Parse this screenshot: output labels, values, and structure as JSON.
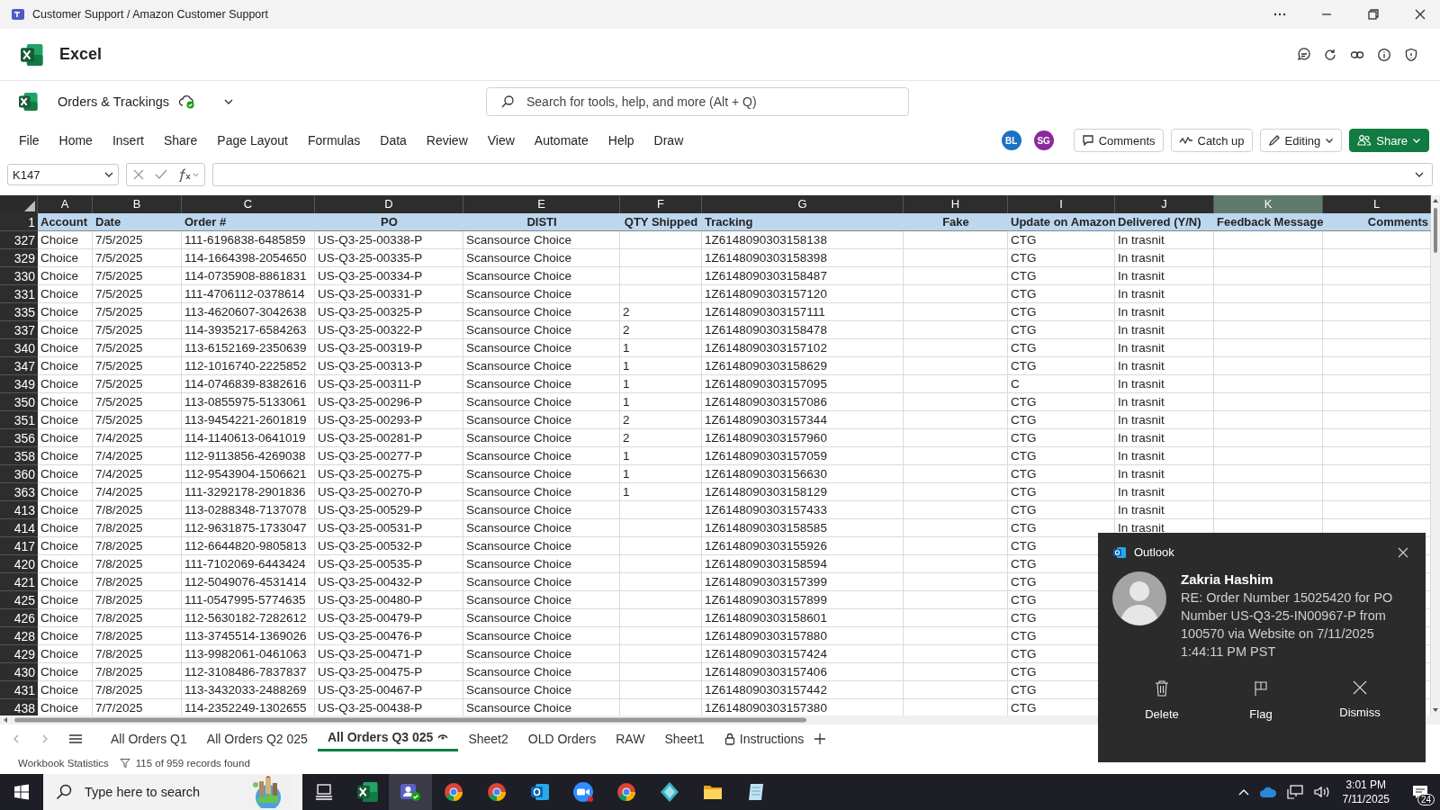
{
  "window": {
    "title": "Customer Support / Amazon Customer Support"
  },
  "app": {
    "name": "Excel"
  },
  "document": {
    "title": "Orders & Trackings",
    "saved": true
  },
  "search": {
    "placeholder": "Search for tools, help, and more (Alt + Q)"
  },
  "menu": [
    "File",
    "Home",
    "Insert",
    "Share",
    "Page Layout",
    "Formulas",
    "Data",
    "Review",
    "View",
    "Automate",
    "Help",
    "Draw"
  ],
  "collaborators": [
    {
      "initials": "BL",
      "color": "#1b72c4"
    },
    {
      "initials": "SG",
      "color": "#8a2a9b"
    }
  ],
  "toolbar_buttons": [
    {
      "label": "Comments",
      "kind": "comments"
    },
    {
      "label": "Catch up",
      "kind": "catchup"
    },
    {
      "label": "Editing",
      "kind": "editing"
    },
    {
      "label": "Share",
      "kind": "share"
    }
  ],
  "name_box": {
    "value": "K147"
  },
  "sheet": {
    "header_row": "1",
    "columns": [
      {
        "letter": "A",
        "header": "Account",
        "selected": false
      },
      {
        "letter": "B",
        "header": "Date",
        "selected": false
      },
      {
        "letter": "C",
        "header": "Order #",
        "selected": false
      },
      {
        "letter": "D",
        "header": "PO",
        "selected": false
      },
      {
        "letter": "E",
        "header": "DISTI",
        "selected": false
      },
      {
        "letter": "F",
        "header": "QTY Shipped",
        "selected": false
      },
      {
        "letter": "G",
        "header": "Tracking",
        "selected": false
      },
      {
        "letter": "H",
        "header": "Fake",
        "selected": false
      },
      {
        "letter": "I",
        "header": "Update on Amazon",
        "selected": false
      },
      {
        "letter": "J",
        "header": "Delivered (Y/N)",
        "selected": false
      },
      {
        "letter": "K",
        "header": "Feedback Message",
        "selected": true
      },
      {
        "letter": "L",
        "header": "Comments",
        "selected": false
      }
    ],
    "rows": [
      {
        "row": "327",
        "account": "Choice",
        "date": "7/5/2025",
        "order": "111-6196838-6485859",
        "po": "US-Q3-25-00338-P",
        "disti": "Scansource Choice",
        "tracking": "1Z6148090303158138",
        "update": "CTG",
        "delivered": "In trasnit"
      },
      {
        "row": "329",
        "account": "Choice",
        "date": "7/5/2025",
        "order": "114-1664398-2054650",
        "po": "US-Q3-25-00335-P",
        "disti": "Scansource Choice",
        "tracking": "1Z6148090303158398",
        "update": "CTG",
        "delivered": "In trasnit"
      },
      {
        "row": "330",
        "account": "Choice",
        "date": "7/5/2025",
        "order": "114-0735908-8861831",
        "po": "US-Q3-25-00334-P",
        "disti": "Scansource Choice",
        "tracking": "1Z6148090303158487",
        "update": "CTG",
        "delivered": "In trasnit"
      },
      {
        "row": "331",
        "account": "Choice",
        "date": "7/5/2025",
        "order": "111-4706112-0378614",
        "po": "US-Q3-25-00331-P",
        "disti": "Scansource Choice",
        "tracking": "1Z6148090303157120",
        "update": "CTG",
        "delivered": "In trasnit"
      },
      {
        "row": "335",
        "account": "Choice",
        "date": "7/5/2025",
        "order": "113-4620607-3042638",
        "po": "US-Q3-25-00325-P",
        "disti": "Scansource Choice",
        "qty": "2",
        "tracking": "1Z6148090303157111",
        "update": "CTG",
        "delivered": "In trasnit"
      },
      {
        "row": "337",
        "account": "Choice",
        "date": "7/5/2025",
        "order": "114-3935217-6584263",
        "po": "US-Q3-25-00322-P",
        "disti": "Scansource Choice",
        "qty": "2",
        "tracking": "1Z6148090303158478",
        "update": "CTG",
        "delivered": "In trasnit"
      },
      {
        "row": "340",
        "account": "Choice",
        "date": "7/5/2025",
        "order": "113-6152169-2350639",
        "po": "US-Q3-25-00319-P",
        "disti": "Scansource Choice",
        "qty": "1",
        "tracking": "1Z6148090303157102",
        "update": "CTG",
        "delivered": "In trasnit"
      },
      {
        "row": "347",
        "account": "Choice",
        "date": "7/5/2025",
        "order": "112-1016740-2225852",
        "po": "US-Q3-25-00313-P",
        "disti": "Scansource Choice",
        "qty": "1",
        "tracking": "1Z6148090303158629",
        "update": "CTG",
        "delivered": "In trasnit"
      },
      {
        "row": "349",
        "account": "Choice",
        "date": "7/5/2025",
        "order": "114-0746839-8382616",
        "po": "US-Q3-25-00311-P",
        "disti": "Scansource Choice",
        "qty": "1",
        "tracking": "1Z6148090303157095",
        "update": "C",
        "delivered": "In trasnit"
      },
      {
        "row": "350",
        "account": "Choice",
        "date": "7/5/2025",
        "order": "113-0855975-5133061",
        "po": "US-Q3-25-00296-P",
        "disti": "Scansource Choice",
        "qty": "1",
        "tracking": "1Z6148090303157086",
        "update": "CTG",
        "delivered": "In trasnit"
      },
      {
        "row": "351",
        "account": "Choice",
        "date": "7/5/2025",
        "order": "113-9454221-2601819",
        "po": "US-Q3-25-00293-P",
        "disti": "Scansource Choice",
        "qty": "2",
        "tracking": "1Z6148090303157344",
        "update": "CTG",
        "delivered": "In trasnit"
      },
      {
        "row": "356",
        "account": "Choice",
        "date": "7/4/2025",
        "order": "114-1140613-0641019",
        "po": "US-Q3-25-00281-P",
        "disti": "Scansource Choice",
        "qty": "2",
        "tracking": "1Z6148090303157960",
        "update": "CTG",
        "delivered": "In trasnit"
      },
      {
        "row": "358",
        "account": "Choice",
        "date": "7/4/2025",
        "order": "112-9113856-4269038",
        "po": "US-Q3-25-00277-P",
        "disti": "Scansource Choice",
        "qty": "1",
        "tracking": "1Z6148090303157059",
        "update": "CTG",
        "delivered": "In trasnit"
      },
      {
        "row": "360",
        "account": "Choice",
        "date": "7/4/2025",
        "order": "112-9543904-1506621",
        "po": "US-Q3-25-00275-P",
        "disti": "Scansource Choice",
        "qty": "1",
        "tracking": "1Z6148090303156630",
        "update": "CTG",
        "delivered": "In trasnit"
      },
      {
        "row": "363",
        "account": "Choice",
        "date": "7/4/2025",
        "order": "111-3292178-2901836",
        "po": "US-Q3-25-00270-P",
        "disti": "Scansource Choice",
        "qty": "1",
        "tracking": "1Z6148090303158129",
        "update": "CTG",
        "delivered": "In trasnit"
      },
      {
        "row": "413",
        "account": "Choice",
        "date": "7/8/2025",
        "order": "113-0288348-7137078",
        "po": "US-Q3-25-00529-P",
        "disti": "Scansource Choice",
        "tracking": "1Z6148090303157433",
        "update": "CTG",
        "delivered": "In trasnit"
      },
      {
        "row": "414",
        "account": "Choice",
        "date": "7/8/2025",
        "order": "112-9631875-1733047",
        "po": "US-Q3-25-00531-P",
        "disti": "Scansource Choice",
        "tracking": "1Z6148090303158585",
        "update": "CTG",
        "delivered": "In trasnit"
      },
      {
        "row": "417",
        "account": "Choice",
        "date": "7/8/2025",
        "order": "112-6644820-9805813",
        "po": "US-Q3-25-00532-P",
        "disti": "Scansource Choice",
        "tracking": "1Z6148090303155926",
        "update": "CTG"
      },
      {
        "row": "420",
        "account": "Choice",
        "date": "7/8/2025",
        "order": "111-7102069-6443424",
        "po": "US-Q3-25-00535-P",
        "disti": "Scansource Choice",
        "tracking": "1Z6148090303158594",
        "update": "CTG"
      },
      {
        "row": "421",
        "account": "Choice",
        "date": "7/8/2025",
        "order": "112-5049076-4531414",
        "po": "US-Q3-25-00432-P",
        "disti": "Scansource Choice",
        "tracking": "1Z6148090303157399",
        "update": "CTG"
      },
      {
        "row": "425",
        "account": "Choice",
        "date": "7/8/2025",
        "order": "111-0547995-5774635",
        "po": "US-Q3-25-00480-P",
        "disti": "Scansource Choice",
        "tracking": "1Z6148090303157899",
        "update": "CTG"
      },
      {
        "row": "426",
        "account": "Choice",
        "date": "7/8/2025",
        "order": "112-5630182-7282612",
        "po": "US-Q3-25-00479-P",
        "disti": "Scansource Choice",
        "tracking": "1Z6148090303158601",
        "update": "CTG"
      },
      {
        "row": "428",
        "account": "Choice",
        "date": "7/8/2025",
        "order": "113-3745514-1369026",
        "po": "US-Q3-25-00476-P",
        "disti": "Scansource Choice",
        "tracking": "1Z6148090303157880",
        "update": "CTG"
      },
      {
        "row": "429",
        "account": "Choice",
        "date": "7/8/2025",
        "order": "113-9982061-0461063",
        "po": "US-Q3-25-00471-P",
        "disti": "Scansource Choice",
        "tracking": "1Z6148090303157424",
        "update": "CTG"
      },
      {
        "row": "430",
        "account": "Choice",
        "date": "7/8/2025",
        "order": "112-3108486-7837837",
        "po": "US-Q3-25-00475-P",
        "disti": "Scansource Choice",
        "tracking": "1Z6148090303157406",
        "update": "CTG"
      },
      {
        "row": "431",
        "account": "Choice",
        "date": "7/8/2025",
        "order": "113-3432033-2488269",
        "po": "US-Q3-25-00467-P",
        "disti": "Scansource Choice",
        "tracking": "1Z6148090303157442",
        "update": "CTG"
      },
      {
        "row": "438",
        "account": "Choice",
        "date": "7/7/2025",
        "order": "114-2352249-1302655",
        "po": "US-Q3-25-00438-P",
        "disti": "Scansource Choice",
        "tracking": "1Z6148090303157380",
        "update": "CTG"
      }
    ]
  },
  "sheet_tabs": [
    {
      "label": "All Orders Q1",
      "selected": false
    },
    {
      "label": "All Orders Q2 025",
      "selected": false
    },
    {
      "label": "All Orders Q3 025",
      "selected": true,
      "kind": "watched"
    },
    {
      "label": "Sheet2",
      "selected": false
    },
    {
      "label": "OLD Orders",
      "selected": false
    },
    {
      "label": "RAW",
      "selected": false
    },
    {
      "label": "Sheet1",
      "selected": false
    },
    {
      "label": "Instructions",
      "selected": false,
      "kind": "locked"
    }
  ],
  "status_bar": {
    "statistics": "Workbook Statistics",
    "records": "115 of 959 records found"
  },
  "notification": {
    "app": "Outlook",
    "sender": "Zakria Hashim",
    "message": "RE: Order Number 15025420 for PO Number US-Q3-25-IN00967-P from 100570 via Website on 7/11/2025 1:44:11 PM PST",
    "actions": [
      {
        "label": "Delete",
        "kind": "delete"
      },
      {
        "label": "Flag",
        "kind": "flag"
      },
      {
        "label": "Dismiss",
        "kind": "dismiss"
      }
    ]
  },
  "taskbar": {
    "search_placeholder": "Type here to search",
    "apps": [
      {
        "kind": "taskview",
        "selected": false
      },
      {
        "kind": "spreadsheet",
        "selected": false
      },
      {
        "kind": "chat",
        "selected": true
      },
      {
        "kind": "browser",
        "selected": false
      },
      {
        "kind": "browser",
        "selected": false
      },
      {
        "kind": "mail",
        "selected": false
      },
      {
        "kind": "video",
        "selected": false
      },
      {
        "kind": "browser",
        "selected": false
      },
      {
        "kind": "diamond",
        "selected": false
      },
      {
        "kind": "folder",
        "selected": false
      },
      {
        "kind": "notepad",
        "selected": false
      }
    ],
    "time": "3:01 PM",
    "date": "7/11/2025",
    "badge": "24"
  }
}
